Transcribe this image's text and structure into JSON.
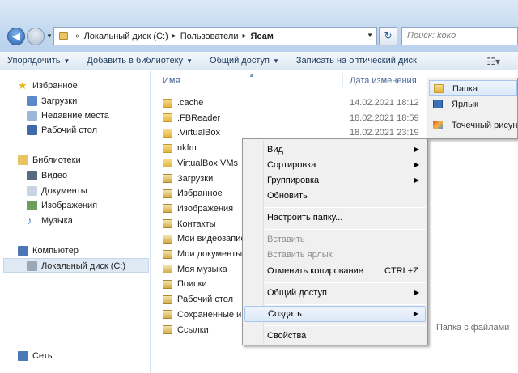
{
  "address": {
    "crumbs": [
      "Локальный диск (C:)",
      "Пользователи",
      "Ясам"
    ],
    "search_placeholder": "Поиск: koko"
  },
  "toolbar": {
    "organize": "Упорядочить",
    "add_library": "Добавить в библиотеку",
    "share": "Общий доступ",
    "burn": "Записать на оптический диск"
  },
  "nav": {
    "favorites": "Избранное",
    "downloads": "Загрузки",
    "recent": "Недавние места",
    "desktop": "Рабочий стол",
    "libraries": "Библиотеки",
    "video": "Видео",
    "documents": "Документы",
    "images": "Изображения",
    "music": "Музыка",
    "computer": "Компьютер",
    "local_disk": "Локальный диск (C:)",
    "network": "Сеть"
  },
  "columns": {
    "name": "Имя",
    "date": "Дата изменения"
  },
  "files": [
    {
      "name": ".cache",
      "date": "14.02.2021 18:12",
      "special": false
    },
    {
      "name": ".FBReader",
      "date": "18.02.2021 18:59",
      "special": false
    },
    {
      "name": ".VirtualBox",
      "date": "18.02.2021 23:19",
      "special": false
    },
    {
      "name": "nkfm",
      "date": "",
      "special": false
    },
    {
      "name": "VirtualBox VMs",
      "date": "",
      "special": false
    },
    {
      "name": "Загрузки",
      "date": "",
      "special": true
    },
    {
      "name": "Избранное",
      "date": "",
      "special": true
    },
    {
      "name": "Изображения",
      "date": "",
      "special": true
    },
    {
      "name": "Контакты",
      "date": "",
      "special": true
    },
    {
      "name": "Мои видеозаписи",
      "date": "",
      "special": true
    },
    {
      "name": "Мои документы",
      "date": "",
      "special": true
    },
    {
      "name": "Моя музыка",
      "date": "",
      "special": true
    },
    {
      "name": "Поиски",
      "date": "",
      "special": true
    },
    {
      "name": "Рабочий стол",
      "date": "",
      "special": true
    },
    {
      "name": "Сохраненные игры",
      "date": "",
      "special": true
    },
    {
      "name": "Ссылки",
      "date": "",
      "special": true
    }
  ],
  "type_text": "Папка с файлами",
  "context_menu": {
    "view": "Вид",
    "sort": "Сортировка",
    "group": "Группировка",
    "refresh": "Обновить",
    "customize": "Настроить папку...",
    "paste": "Вставить",
    "paste_shortcut": "Вставить ярлык",
    "undo_copy": "Отменить копирование",
    "undo_shortcut": "CTRL+Z",
    "share": "Общий доступ",
    "create": "Создать",
    "properties": "Свойства"
  },
  "submenu": {
    "folder": "Папка",
    "shortcut": "Ярлык",
    "bitmap": "Точечный рисунок"
  }
}
